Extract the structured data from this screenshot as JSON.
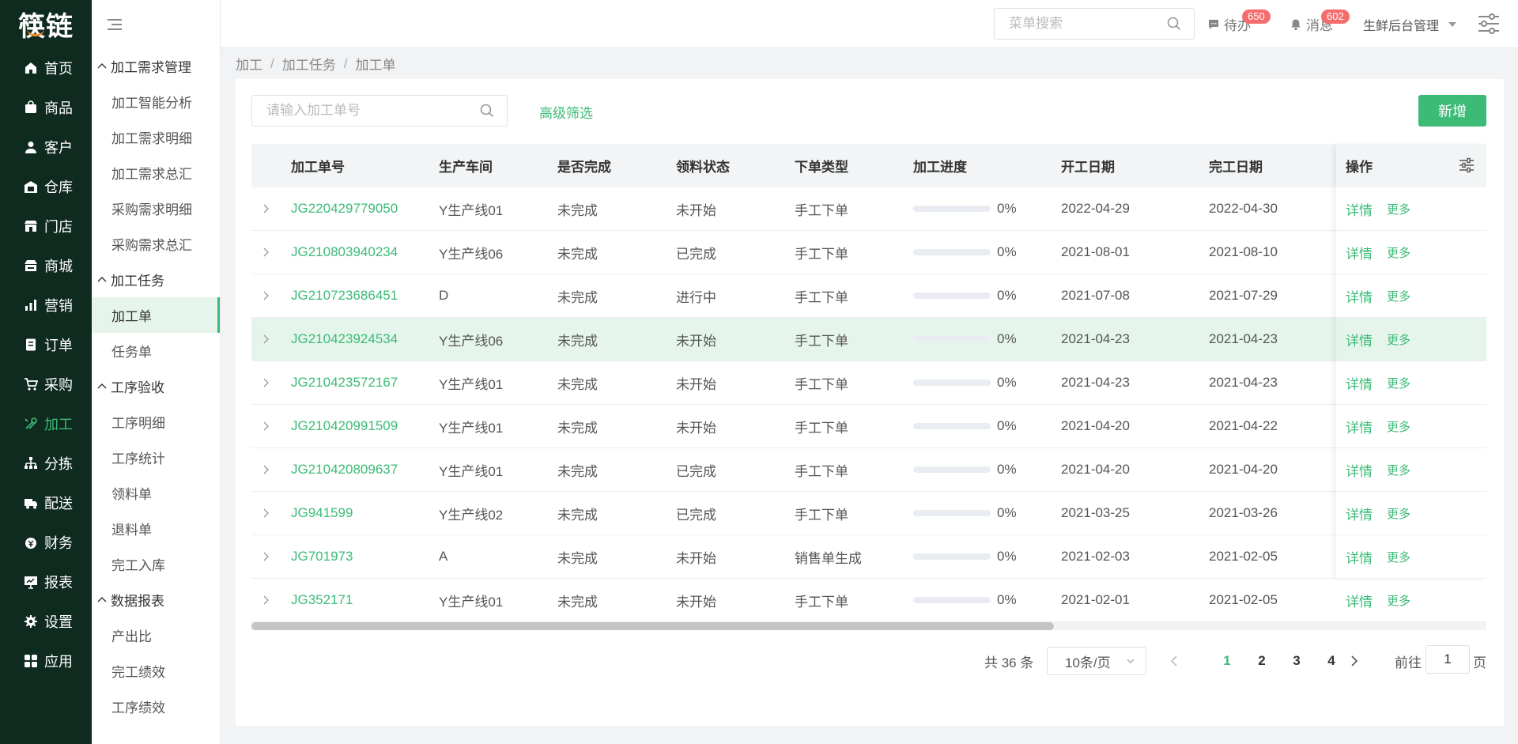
{
  "colors": {
    "accent": "#3cbb77",
    "nav_bg": "#0f2a1f",
    "badge": "#f56c6c"
  },
  "logo": {
    "text": "筷链"
  },
  "leftnav": [
    {
      "label": "首页",
      "icon": "home-icon"
    },
    {
      "label": "商品",
      "icon": "bag-icon"
    },
    {
      "label": "客户",
      "icon": "user-icon"
    },
    {
      "label": "仓库",
      "icon": "warehouse-icon"
    },
    {
      "label": "门店",
      "icon": "store-icon"
    },
    {
      "label": "商城",
      "icon": "mall-icon"
    },
    {
      "label": "营销",
      "icon": "chart-icon"
    },
    {
      "label": "订单",
      "icon": "order-icon"
    },
    {
      "label": "采购",
      "icon": "cart-icon"
    },
    {
      "label": "加工",
      "icon": "tools-icon",
      "active": true
    },
    {
      "label": "分拣",
      "icon": "sort-icon"
    },
    {
      "label": "配送",
      "icon": "truck-icon"
    },
    {
      "label": "财务",
      "icon": "money-icon"
    },
    {
      "label": "报表",
      "icon": "report-icon"
    },
    {
      "label": "设置",
      "icon": "gear-icon"
    },
    {
      "label": "应用",
      "icon": "apps-icon"
    }
  ],
  "subnav": {
    "groups": [
      {
        "title": "加工需求管理",
        "items": [
          "加工智能分析",
          "加工需求明细",
          "加工需求总汇",
          "采购需求明细",
          "采购需求总汇"
        ]
      },
      {
        "title": "加工任务",
        "items": [
          "加工单",
          "任务单"
        ]
      },
      {
        "title": "工序验收",
        "items": [
          "工序明细",
          "工序统计",
          "领料单",
          "退料单",
          "完工入库"
        ]
      },
      {
        "title": "数据报表",
        "items": [
          "产出比",
          "完工绩效",
          "工序绩效"
        ]
      }
    ],
    "active_item": "加工单"
  },
  "header": {
    "search_placeholder": "菜单搜索",
    "todo_label": "待办",
    "todo_count": "650",
    "msg_label": "消息",
    "msg_count": "602",
    "user_label": "生鲜后台管理"
  },
  "breadcrumb": [
    "加工",
    "加工任务",
    "加工单"
  ],
  "toolbar": {
    "search_placeholder": "请输入加工单号",
    "advanced_filter": "高级筛选",
    "add_label": "新增"
  },
  "table": {
    "columns": [
      "加工单号",
      "生产车间",
      "是否完成",
      "领料状态",
      "下单类型",
      "加工进度",
      "开工日期",
      "完工日期",
      "操作"
    ],
    "rows": [
      {
        "no": "JG220429779050",
        "workshop": "Y生产线01",
        "done": "未完成",
        "material": "未开始",
        "type": "手工下单",
        "progress": 0,
        "progress_text": "0%",
        "start": "2022-04-29",
        "end": "2022-04-30"
      },
      {
        "no": "JG210803940234",
        "workshop": "Y生产线06",
        "done": "未完成",
        "material": "已完成",
        "type": "手工下单",
        "progress": 0,
        "progress_text": "0%",
        "start": "2021-08-01",
        "end": "2021-08-10"
      },
      {
        "no": "JG210723686451",
        "workshop": "D",
        "done": "未完成",
        "material": "进行中",
        "type": "手工下单",
        "progress": 0,
        "progress_text": "0%",
        "start": "2021-07-08",
        "end": "2021-07-29"
      },
      {
        "no": "JG210423924534",
        "workshop": "Y生产线06",
        "done": "未完成",
        "material": "未开始",
        "type": "手工下单",
        "progress": 0,
        "progress_text": "0%",
        "start": "2021-04-23",
        "end": "2021-04-23",
        "highlight": true
      },
      {
        "no": "JG210423572167",
        "workshop": "Y生产线01",
        "done": "未完成",
        "material": "未开始",
        "type": "手工下单",
        "progress": 0,
        "progress_text": "0%",
        "start": "2021-04-23",
        "end": "2021-04-23"
      },
      {
        "no": "JG210420991509",
        "workshop": "Y生产线01",
        "done": "未完成",
        "material": "未开始",
        "type": "手工下单",
        "progress": 0,
        "progress_text": "0%",
        "start": "2021-04-20",
        "end": "2021-04-22"
      },
      {
        "no": "JG210420809637",
        "workshop": "Y生产线01",
        "done": "未完成",
        "material": "已完成",
        "type": "手工下单",
        "progress": 0,
        "progress_text": "0%",
        "start": "2021-04-20",
        "end": "2021-04-20"
      },
      {
        "no": "JG941599",
        "workshop": "Y生产线02",
        "done": "未完成",
        "material": "已完成",
        "type": "手工下单",
        "progress": 0,
        "progress_text": "0%",
        "start": "2021-03-25",
        "end": "2021-03-26"
      },
      {
        "no": "JG701973",
        "workshop": "A",
        "done": "未完成",
        "material": "未开始",
        "type": "销售单生成",
        "progress": 0,
        "progress_text": "0%",
        "start": "2021-02-03",
        "end": "2021-02-05"
      },
      {
        "no": "JG352171",
        "workshop": "Y生产线01",
        "done": "未完成",
        "material": "未开始",
        "type": "手工下单",
        "progress": 0,
        "progress_text": "0%",
        "start": "2021-02-01",
        "end": "2021-02-05"
      }
    ],
    "op_detail": "详情",
    "op_more": "更多"
  },
  "pagination": {
    "total": "共 36 条",
    "page_size": "10条/页",
    "pages": [
      "1",
      "2",
      "3",
      "4"
    ],
    "current": "1",
    "goto_label": "前往",
    "goto_value": "1",
    "page_unit": "页"
  }
}
